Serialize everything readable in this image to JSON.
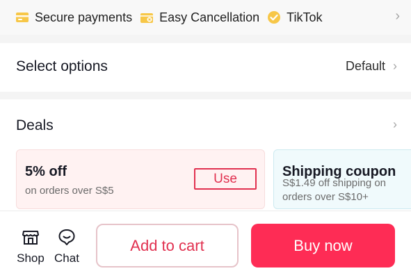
{
  "trust_bar": {
    "items": [
      {
        "label": "Secure payments",
        "icon": "card-icon"
      },
      {
        "label": "Easy Cancellation",
        "icon": "cancel-box-icon"
      },
      {
        "label": "TikTok",
        "icon": "verified-check-icon"
      }
    ],
    "chevron": "›"
  },
  "select_options": {
    "title": "Select options",
    "value": "Default",
    "chevron": "›"
  },
  "deals": {
    "title": "Deals",
    "chevron": "›",
    "cards": [
      {
        "title": "5% off",
        "subtitle": "on orders over S$5",
        "action": "Use"
      },
      {
        "title": "Shipping coupon",
        "subtitle": "S$1.49 off shipping on orders over S$10+"
      }
    ]
  },
  "bottom_bar": {
    "shop_label": "Shop",
    "chat_label": "Chat",
    "add_to_cart": "Add to cart",
    "buy_now": "Buy now"
  },
  "colors": {
    "accent": "#fe2c55",
    "accent_text": "#e1304f",
    "badge_yellow": "#f7c748"
  }
}
